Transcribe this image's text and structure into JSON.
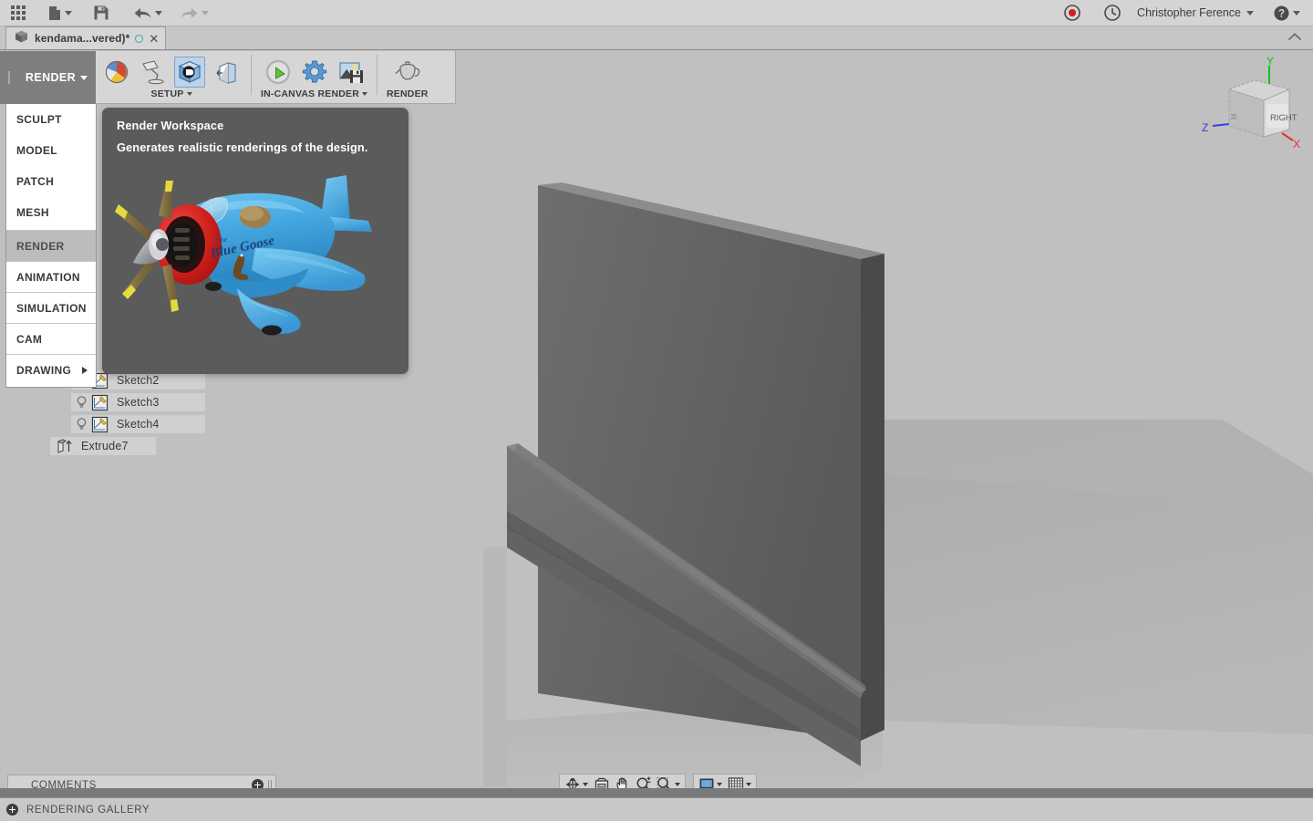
{
  "app": {
    "background_color": "#c0c0c0",
    "accent_color": "#bcd4ea"
  },
  "titlebar": {
    "icons": [
      {
        "name": "app-grid-icon",
        "glyph": "grid"
      },
      {
        "name": "new-file-icon",
        "glyph": "file"
      },
      {
        "name": "save-icon",
        "glyph": "floppy"
      },
      {
        "name": "undo-icon",
        "glyph": "undo"
      },
      {
        "name": "redo-icon",
        "glyph": "redo"
      }
    ],
    "record_label": "record-icon",
    "history_label": "clock-icon",
    "user_name": "Christopher Ference",
    "help_label": "help-icon"
  },
  "tabbar": {
    "document_title": "kendama...vered)*",
    "cube_icon": "document-cube-icon",
    "save_state_icon": "unsaved-circle-icon",
    "close_icon": "close-icon",
    "collapse_icon": "collapse-chevron-icon"
  },
  "workspace": {
    "current": "RENDER",
    "menu_items": [
      {
        "label": "SCULPT",
        "active": false,
        "submenu": false
      },
      {
        "label": "MODEL",
        "active": false,
        "submenu": false
      },
      {
        "label": "PATCH",
        "active": false,
        "submenu": false
      },
      {
        "label": "MESH",
        "active": false,
        "submenu": false
      },
      {
        "label": "RENDER",
        "active": true,
        "submenu": false
      },
      {
        "label": "ANIMATION",
        "active": false,
        "submenu": false
      },
      {
        "label": "SIMULATION",
        "active": false,
        "submenu": false
      },
      {
        "label": "CAM",
        "active": false,
        "submenu": false
      },
      {
        "label": "DRAWING",
        "active": false,
        "submenu": true
      }
    ]
  },
  "ribbon": {
    "groups": [
      {
        "label": "SETUP",
        "has_caret": true,
        "tools": [
          {
            "name": "scene-settings-icon"
          },
          {
            "name": "lamp-appearance-icon"
          },
          {
            "name": "decal-cube-icon",
            "selected": true
          },
          {
            "name": "texture-map-controls-icon"
          }
        ]
      },
      {
        "label": "IN-CANVAS RENDER",
        "has_caret": true,
        "tools": [
          {
            "name": "in-canvas-render-icon"
          },
          {
            "name": "render-settings-gear-icon"
          },
          {
            "name": "capture-image-icon"
          }
        ]
      },
      {
        "label": "RENDER",
        "has_caret": false,
        "tools": [
          {
            "name": "render-teapot-icon"
          }
        ]
      }
    ]
  },
  "tooltip": {
    "title": "Render Workspace",
    "description": "Generates realistic renderings of the design.",
    "image_name": "blue-toy-airplane-render-preview",
    "image_colors": {
      "body": "#4aa8e0",
      "body_dark": "#2e87c4",
      "cowling": "#d02020",
      "propeller": "#8d7a4e",
      "tip": "#e8e23a",
      "spinner": "#bdbdc2",
      "canopy": "#9fd2ea"
    }
  },
  "browser": {
    "items": [
      {
        "label": "Sketch2",
        "icon": "sketch-icon",
        "has_bulb": true
      },
      {
        "label": "Sketch3",
        "icon": "sketch-icon",
        "has_bulb": true
      },
      {
        "label": "Sketch4",
        "icon": "sketch-icon",
        "has_bulb": true
      },
      {
        "label": "Extrude7",
        "icon": "extrude-icon",
        "has_bulb": false
      }
    ]
  },
  "viewcube": {
    "face_label": "RIGHT",
    "axes": [
      {
        "label": "Y",
        "color": "#12c412"
      },
      {
        "label": "X",
        "color": "#e8302a"
      },
      {
        "label": "Z",
        "color": "#3a3ae0"
      }
    ]
  },
  "navbar": {
    "group1": [
      {
        "name": "orbit-icon",
        "has_caret": true
      },
      {
        "name": "look-at-icon",
        "has_caret": false
      },
      {
        "name": "pan-icon",
        "has_caret": false
      },
      {
        "name": "zoom-icon",
        "has_caret": false
      },
      {
        "name": "fit-icon",
        "has_caret": true
      }
    ],
    "group2": [
      {
        "name": "display-settings-icon",
        "has_caret": true
      },
      {
        "name": "grid-snaps-icon",
        "has_caret": true
      }
    ]
  },
  "comments": {
    "label": "COMMENTS",
    "add_icon": "add-comment-icon",
    "resize_icon": "resize-gripper"
  },
  "gallery": {
    "label": "RENDERING GALLERY",
    "expand_icon": "expand-gallery-icon"
  }
}
